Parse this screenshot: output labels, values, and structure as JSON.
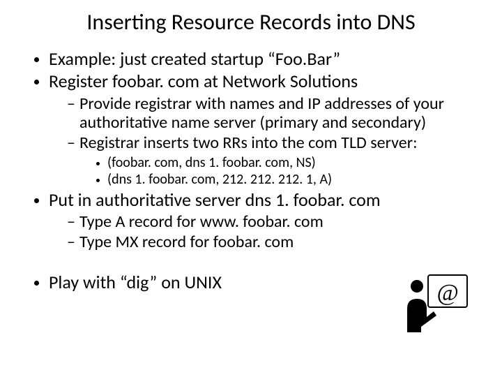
{
  "title": "Inserting Resource Records into DNS",
  "bullets": {
    "b1": "Example: just created startup “Foo.Bar”",
    "b2": "Register foobar. com at Network Solutions",
    "b2_sub1": "Provide registrar with names and IP addresses of your authoritative name server (primary and secondary)",
    "b2_sub2": "Registrar inserts two RRs into the com TLD server:",
    "b2_sub2_rr1": "(foobar. com, dns 1. foobar. com, NS)",
    "b2_sub2_rr2": "(dns 1. foobar. com, 212. 212. 212. 1, A)",
    "b3": "Put in authoritative server dns 1. foobar. com",
    "b3_sub1": "Type A record for www. foobar. com",
    "b3_sub2": "Type MX record for foobar. com",
    "b4": "Play with “dig” on UNIX"
  },
  "icon_name": "at-symbol-person-icon"
}
